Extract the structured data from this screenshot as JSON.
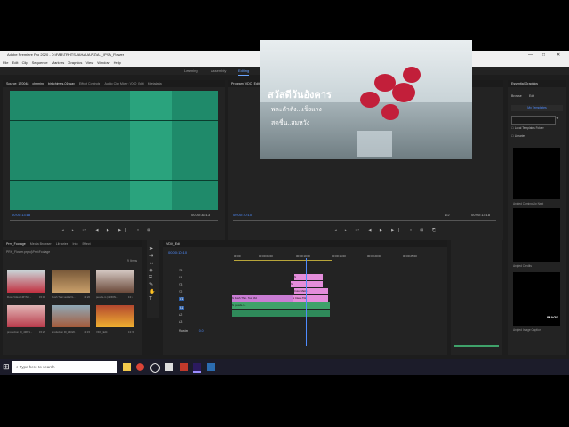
{
  "window": {
    "title": "Adobe Premiere Pro 2020 - D:\\FAB\\TRHTSUAHAUAIPZ\\AL_\\PVA_Flower",
    "controls": [
      "—",
      "□",
      "✕"
    ]
  },
  "menu": [
    "File",
    "Edit",
    "Clip",
    "Sequence",
    "Markers",
    "Graphics",
    "View",
    "Window",
    "Help"
  ],
  "workspaces": {
    "items": [
      "Learning",
      "Assembly",
      "Editing",
      "Color",
      "Effects",
      "Audio",
      "Graphics",
      "Libraries"
    ],
    "active": "Editing",
    "overflow": "»"
  },
  "source_panel": {
    "tabs": [
      "Source: 170048__chirming__birdchimes-01.wav",
      "Effect Controls",
      "Audio Clip Mixer: VDO_Edit",
      "Metadata"
    ],
    "timecode_in": "00:00:13:18",
    "timecode_dur": "00:00:38:13"
  },
  "program_panel": {
    "tabs": [
      "Program: VDO_Edit"
    ],
    "timecode": "00:00:10:10",
    "fit": "1/2",
    "duration": "00:00:13:18",
    "overlay_line1": "สวัสดีวันอังคาร",
    "overlay_line2": "พละกำลัง..แข็งแรง",
    "overlay_line3": "สดชื่น..สมหวัง"
  },
  "project_panel": {
    "tabs": [
      "Prm_Footage",
      "Media Browser",
      "Libraries",
      "Info",
      "Effect"
    ],
    "path": "PRH_Flower.prproj\\Prm\\Footage",
    "count": "9 Items",
    "items": [
      {
        "name": "Rush Video  1MYNC...",
        "dur": "15:00"
      },
      {
        "name": "Rush Thai  xa13aVL...",
        "dur": "13:20"
      },
      {
        "name": "pexels-m (KZZ0NI...",
        "dur": "13:5"
      },
      {
        "name": "production ID_43871...",
        "dur": "15:27"
      },
      {
        "name": "production ID_44020...",
        "dur": "13:15"
      },
      {
        "name": "VDO_Edit",
        "dur": "13:15"
      }
    ]
  },
  "timeline": {
    "tab": "VDO_Edit",
    "timecode": "00:00:10:10",
    "ruler": [
      "00:00",
      "00:00:05:00",
      "00:00:10:00",
      "00:00:15:00",
      "00:00:20:00",
      "00:00:25:00"
    ],
    "video_tracks": [
      "V5",
      "V4",
      "V3",
      "V2",
      "V1"
    ],
    "audio_tracks": [
      "A1",
      "A2",
      "A3"
    ],
    "master": "Master",
    "master_val": "0.0",
    "clips": [
      {
        "track": "V4",
        "label": "fx"
      },
      {
        "track": "V3",
        "label": "fx"
      },
      {
        "track": "V2",
        "label": "Color Matte"
      },
      {
        "track": "V1",
        "label": "fx  Rush Thai..  Text Vid"
      },
      {
        "track": "V1b",
        "label": "fx  pexels-m.."
      },
      {
        "track": "V1c",
        "label": "fx  Clean  Title"
      }
    ]
  },
  "essential_graphics": {
    "title": "Essential Graphics",
    "tabs": [
      "Browse",
      "Edit"
    ],
    "my_templates": "My Templates",
    "search_placeholder": "",
    "local_folder": "Local Templates Folder",
    "libraries": "Libraries",
    "templates": [
      "Angled Coming Up Next",
      "Angled Credits",
      "Angled Image Caption"
    ],
    "thumb_text": "IMAGE"
  },
  "taskbar": {
    "search_placeholder": "Type here to search"
  },
  "colors": {
    "accent": "#4f8cff",
    "wave": "#1f8a6a",
    "clip_pink": "#e48ddb",
    "clip_green": "#3fa26a",
    "premiere": "#2b1a5e"
  }
}
